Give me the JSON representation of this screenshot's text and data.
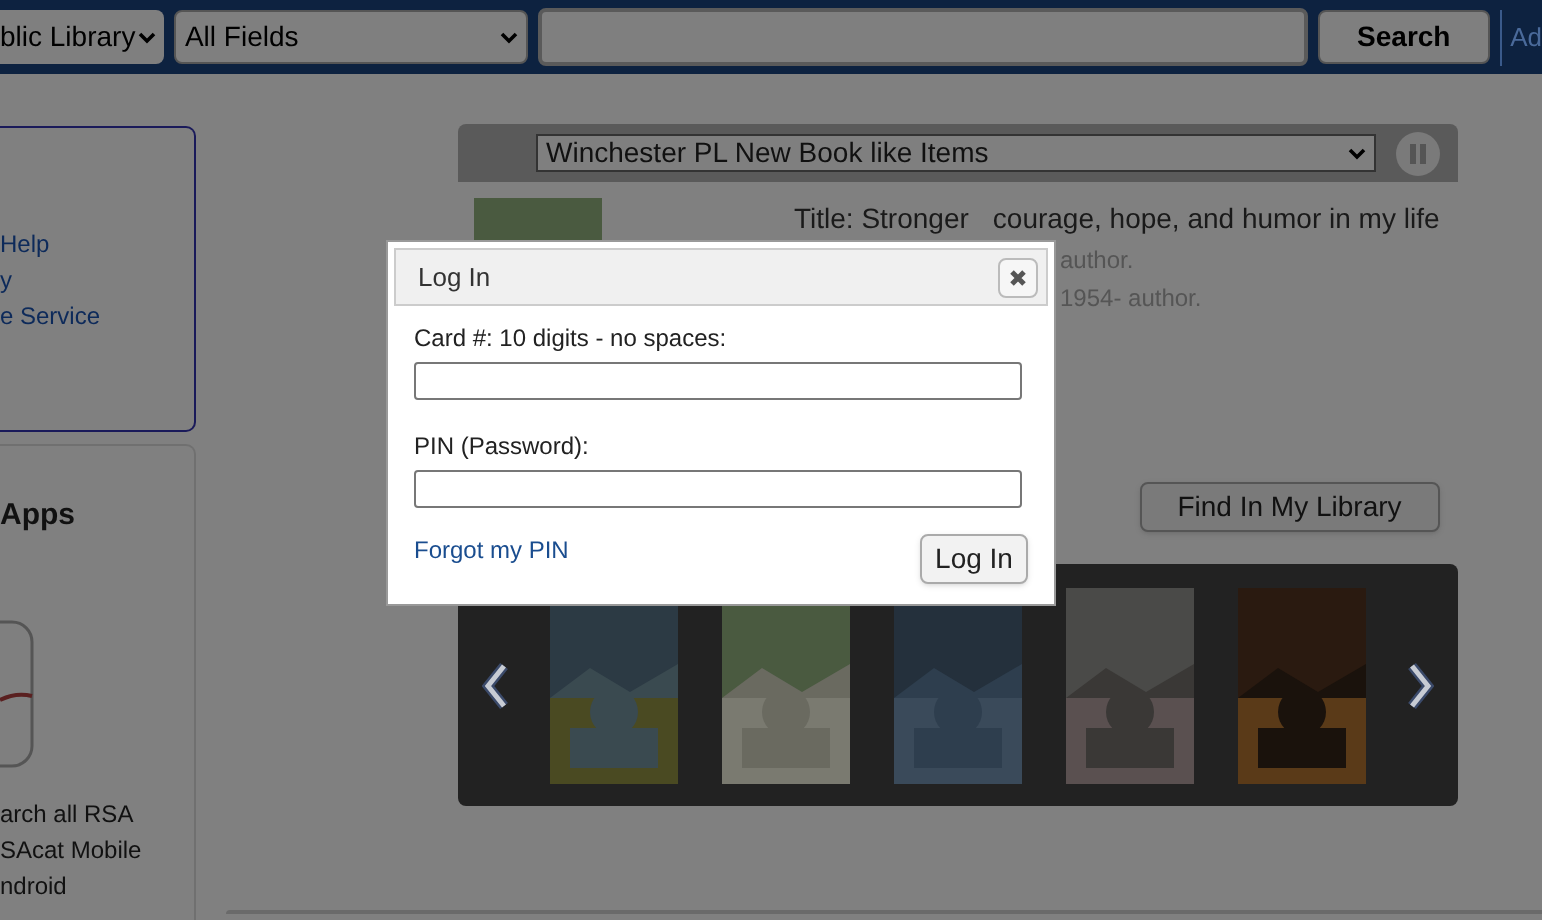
{
  "header": {
    "library_select": "blic Library",
    "field_select": "All Fields",
    "search_button": "Search",
    "cut_link": "Ad"
  },
  "sidebar": {
    "links": [
      "Help",
      "y",
      "e Service"
    ],
    "apps_title": "Apps",
    "apps_lines": [
      "arch all RSA",
      "SAcat Mobile",
      "ndroid"
    ]
  },
  "feature": {
    "list_select": "Winchester PL New Book like Items",
    "title_label": "Title: Stronger",
    "title_rest": "courage, hope, and humor in my life",
    "author_lines": [
      "author.",
      "1954- author."
    ],
    "find_button": "Find In My Library"
  },
  "dialog": {
    "title": "Log In",
    "fields": [
      {
        "label": "Card #: 10 digits - no spaces:"
      },
      {
        "label": "PIN (Password):"
      }
    ],
    "forgot_link": "Forgot my PIN",
    "submit": "Log In"
  }
}
